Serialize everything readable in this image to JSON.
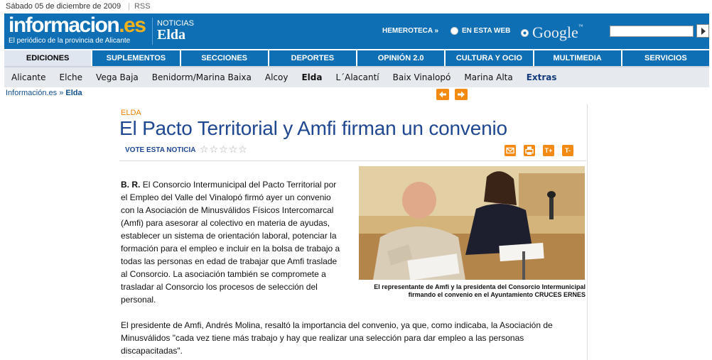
{
  "topbar": {
    "date": "Sábado 05 de diciembre de 2009",
    "rss": "RSS"
  },
  "header": {
    "logo_main": "informacion",
    "logo_tld": ".es",
    "logo_tagline": "El periódico de la provincia de Alicante",
    "section_small": "NOTICIAS",
    "section_big": "Elda",
    "hemeroteca": "HEMEROTECA »",
    "search_web_label": "EN ESTA WEB",
    "search_google_label": "Google",
    "search_value": ""
  },
  "main_nav": [
    "EDICIONES",
    "SUPLEMENTOS",
    "SECCIONES",
    "DEPORTES",
    "OPINIÓN 2.0",
    "CULTURA Y OCIO",
    "MULTIMEDIA",
    "SERVICIOS"
  ],
  "sub_nav": [
    "Alicante",
    "Elche",
    "Vega Baja",
    "Benidorm/Marina Baixa",
    "Alcoy",
    "Elda",
    "L´Alacantí",
    "Baix Vinalopó",
    "Marina Alta",
    "Extras"
  ],
  "breadcrumb": {
    "home": "Información.es",
    "sep": " » ",
    "current": "Elda"
  },
  "article": {
    "kicker": "ELDA",
    "headline": "El Pacto Territorial y Amfi firman un convenio",
    "vote_label": "VOTE ESTA NOTICIA",
    "rating": 0,
    "byline": "B. R.",
    "paragraph1": "El Consorcio Intermunicipal del Pacto Territorial por el Empleo del Valle del Vinalopó firmó ayer un convenio con la Asociación de Minusválidos Físicos Intercomarcal (Amfi) para asesorar al colectivo en materia de ayudas, establecer un sistema de orientación laboral, potenciar la formación para el empleo e incluir en la bolsa de trabajo a todas las personas en edad de trabajar que Amfi traslade al Consorcio. La asociación también se compromete a trasladar al Consorcio los procesos de selección del personal.",
    "paragraph2": "El presidente de Amfi, Andrés Molina, resaltó la importancia del convenio, ya que, como indicaba, la Asociación de Minusválidos \"cada vez tiene más trabajo y hay que realizar una selección para dar empleo a las personas discapacitadas\".",
    "photo_caption": "El representante de Amfi y la presidenta del Consorcio Intermunicipal firmando el convenio en el Ayuntamiento CRUCES ERNES",
    "tools": {
      "font_up": "T+",
      "font_down": "T-"
    }
  }
}
